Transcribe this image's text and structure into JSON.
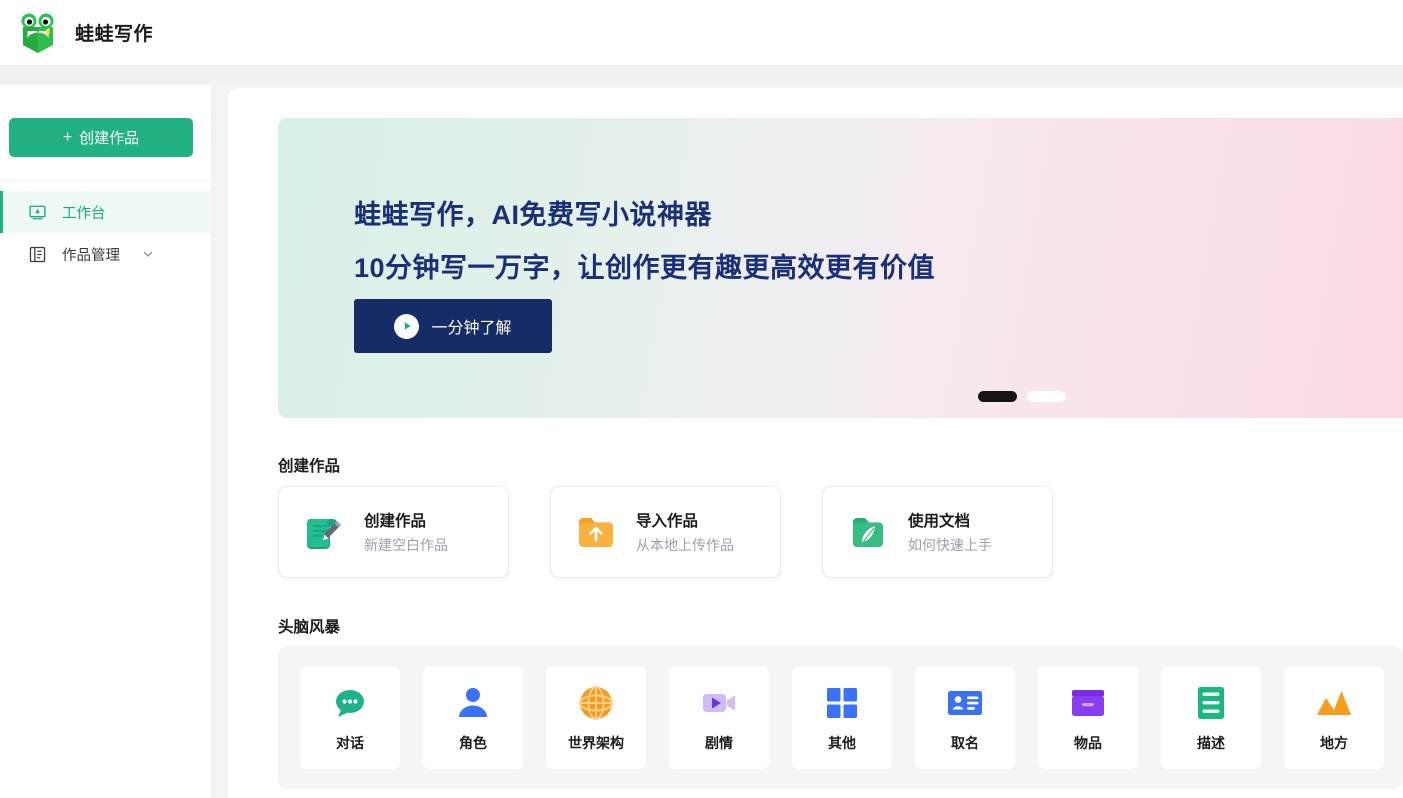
{
  "header": {
    "brand": "蛙蛙写作",
    "logo_icon": "frog-book-logo"
  },
  "sidebar": {
    "create_button": {
      "label": "创建作品",
      "plus": "+",
      "color": "#21b185"
    },
    "items": [
      {
        "label": "工作台",
        "icon": "workbench-monitor-icon",
        "active": true
      },
      {
        "label": "作品管理",
        "icon": "book-list-icon",
        "active": false,
        "chevron": "chevron-down-icon"
      }
    ]
  },
  "banner": {
    "headline_1": "蛙蛙写作，AI免费写小说神器",
    "headline_2": "10分钟写一万字，让创作更有趣更高效更有价值",
    "cta_label": "一分钟了解",
    "cta_icon": "play-circle-icon",
    "cta_color": "#152c66",
    "text_color": "#1b2f78",
    "gradient_from": "#d8f0e6",
    "gradient_to": "#fbdbe5",
    "carousel": {
      "total": 2,
      "active_index": 0
    }
  },
  "create_section": {
    "title": "创建作品",
    "cards": [
      {
        "title": "创建作品",
        "subtitle": "新建空白作品",
        "icon": "scroll-pen-icon",
        "color": "#1aa882"
      },
      {
        "title": "导入作品",
        "subtitle": "从本地上传作品",
        "icon": "folder-upload-icon",
        "color": "#f5a93a"
      },
      {
        "title": "使用文档",
        "subtitle": "如何快速上手",
        "icon": "folder-feather-icon",
        "color": "#2fb87f"
      }
    ]
  },
  "brainstorm_section": {
    "title": "头脑风暴",
    "tiles": [
      {
        "label": "对话",
        "icon": "speech-bubble-icon",
        "color": "#1fb189"
      },
      {
        "label": "角色",
        "icon": "person-icon",
        "color": "#3b72f5"
      },
      {
        "label": "世界架构",
        "icon": "globe-icon",
        "color": "#f79b1e"
      },
      {
        "label": "剧情",
        "icon": "video-camera-icon",
        "color": "#b39ff0"
      },
      {
        "label": "其他",
        "icon": "grid-squares-icon",
        "color": "#3b72f5"
      },
      {
        "label": "取名",
        "icon": "id-card-icon",
        "color": "#3b72f5"
      },
      {
        "label": "物品",
        "icon": "storage-box-icon",
        "color": "#8a3df0"
      },
      {
        "label": "描述",
        "icon": "document-lines-icon",
        "color": "#19b87e"
      },
      {
        "label": "地方",
        "icon": "mountains-icon",
        "color": "#f99b1c"
      }
    ]
  }
}
